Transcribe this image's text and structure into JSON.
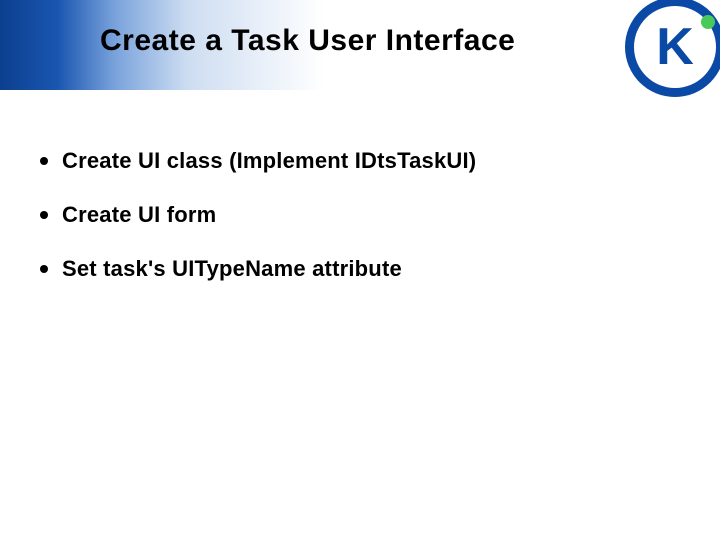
{
  "title": "Create a Task User Interface",
  "bullets": [
    "Create UI class (Implement IDtsTaskUI)",
    "Create UI form",
    "Set task's UITypeName attribute"
  ],
  "logo_letter": "K"
}
